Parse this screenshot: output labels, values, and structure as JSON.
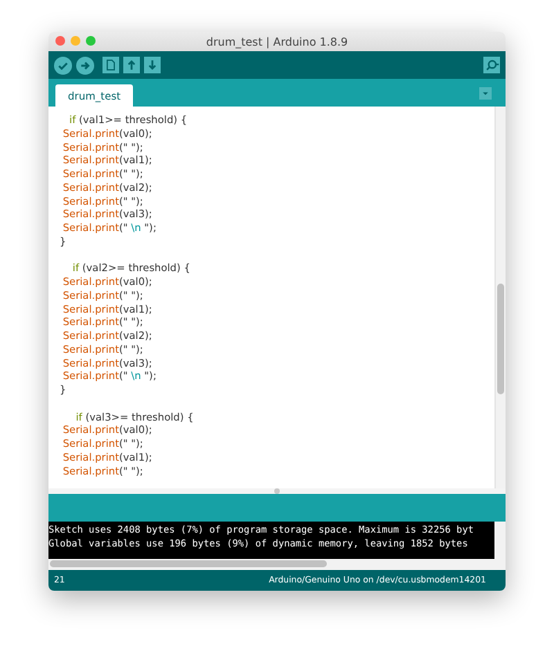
{
  "window": {
    "title": "drum_test | Arduino 1.8.9"
  },
  "tabs": [
    {
      "label": "drum_test",
      "selected": true
    }
  ],
  "code_lines": [
    {
      "kind": "code",
      "segments": [
        {
          "kind": "keyword",
          "text": "   if"
        },
        {
          "kind": "plain",
          "text": " (val1>= threshold) {"
        }
      ]
    },
    {
      "kind": "code",
      "segments": [
        {
          "kind": "function",
          "text": " Serial.print"
        },
        {
          "kind": "plain",
          "text": "(val0);"
        }
      ]
    },
    {
      "kind": "code",
      "segments": [
        {
          "kind": "function",
          "text": " Serial.print"
        },
        {
          "kind": "plain",
          "text": "(\" \");"
        }
      ]
    },
    {
      "kind": "code",
      "segments": [
        {
          "kind": "function",
          "text": " Serial.print"
        },
        {
          "kind": "plain",
          "text": "(val1);"
        }
      ]
    },
    {
      "kind": "code",
      "segments": [
        {
          "kind": "function",
          "text": " Serial.print"
        },
        {
          "kind": "plain",
          "text": "(\" \");"
        }
      ]
    },
    {
      "kind": "code",
      "segments": [
        {
          "kind": "function",
          "text": " Serial.print"
        },
        {
          "kind": "plain",
          "text": "(val2);"
        }
      ]
    },
    {
      "kind": "code",
      "segments": [
        {
          "kind": "function",
          "text": " Serial.print"
        },
        {
          "kind": "plain",
          "text": "(\" \");"
        }
      ]
    },
    {
      "kind": "code",
      "segments": [
        {
          "kind": "function",
          "text": " Serial.print"
        },
        {
          "kind": "plain",
          "text": "(val3);"
        }
      ]
    },
    {
      "kind": "code",
      "segments": [
        {
          "kind": "function",
          "text": " Serial.print"
        },
        {
          "kind": "plain",
          "text": "(\" "
        },
        {
          "kind": "escape",
          "text": "\\n"
        },
        {
          "kind": "plain",
          "text": " \");"
        }
      ]
    },
    {
      "kind": "code",
      "segments": [
        {
          "kind": "plain",
          "text": "}"
        }
      ]
    },
    {
      "kind": "blank"
    },
    {
      "kind": "code",
      "segments": [
        {
          "kind": "keyword",
          "text": "    if"
        },
        {
          "kind": "plain",
          "text": " (val2>= threshold) {"
        }
      ]
    },
    {
      "kind": "code",
      "segments": [
        {
          "kind": "function",
          "text": " Serial.print"
        },
        {
          "kind": "plain",
          "text": "(val0);"
        }
      ]
    },
    {
      "kind": "code",
      "segments": [
        {
          "kind": "function",
          "text": " Serial.print"
        },
        {
          "kind": "plain",
          "text": "(\" \");"
        }
      ]
    },
    {
      "kind": "code",
      "segments": [
        {
          "kind": "function",
          "text": " Serial.print"
        },
        {
          "kind": "plain",
          "text": "(val1);"
        }
      ]
    },
    {
      "kind": "code",
      "segments": [
        {
          "kind": "function",
          "text": " Serial.print"
        },
        {
          "kind": "plain",
          "text": "(\" \");"
        }
      ]
    },
    {
      "kind": "code",
      "segments": [
        {
          "kind": "function",
          "text": " Serial.print"
        },
        {
          "kind": "plain",
          "text": "(val2);"
        }
      ]
    },
    {
      "kind": "code",
      "segments": [
        {
          "kind": "function",
          "text": " Serial.print"
        },
        {
          "kind": "plain",
          "text": "(\" \");"
        }
      ]
    },
    {
      "kind": "code",
      "segments": [
        {
          "kind": "function",
          "text": " Serial.print"
        },
        {
          "kind": "plain",
          "text": "(val3);"
        }
      ]
    },
    {
      "kind": "code",
      "segments": [
        {
          "kind": "function",
          "text": " Serial.print"
        },
        {
          "kind": "plain",
          "text": "(\" "
        },
        {
          "kind": "escape",
          "text": "\\n"
        },
        {
          "kind": "plain",
          "text": " \");"
        }
      ]
    },
    {
      "kind": "code",
      "segments": [
        {
          "kind": "plain",
          "text": "}"
        }
      ]
    },
    {
      "kind": "blank"
    },
    {
      "kind": "code",
      "segments": [
        {
          "kind": "keyword",
          "text": "     if"
        },
        {
          "kind": "plain",
          "text": " (val3>= threshold) {"
        }
      ]
    },
    {
      "kind": "code",
      "segments": [
        {
          "kind": "function",
          "text": " Serial.print"
        },
        {
          "kind": "plain",
          "text": "(val0);"
        }
      ]
    },
    {
      "kind": "code",
      "segments": [
        {
          "kind": "function",
          "text": " Serial.print"
        },
        {
          "kind": "plain",
          "text": "(\" \");"
        }
      ]
    },
    {
      "kind": "code",
      "segments": [
        {
          "kind": "function",
          "text": " Serial.print"
        },
        {
          "kind": "plain",
          "text": "(val1);"
        }
      ]
    },
    {
      "kind": "code",
      "segments": [
        {
          "kind": "function",
          "text": " Serial.print"
        },
        {
          "kind": "plain",
          "text": "(\" \");"
        }
      ]
    }
  ],
  "console_lines": [
    "Sketch uses 2408 bytes (7%) of program storage space. Maximum is 32256 byt",
    "Global variables use 196 bytes (9%) of dynamic memory, leaving 1852 bytes"
  ],
  "status_bar": {
    "line": "21",
    "board": "Arduino/Genuino Uno on /dev/cu.usbmodem14201"
  }
}
